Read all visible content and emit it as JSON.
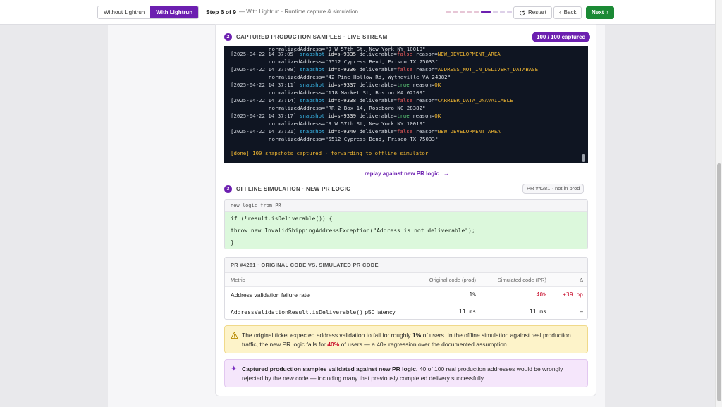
{
  "toolbar": {
    "mode_without": "Without Lightrun",
    "mode_with": "With Lightrun",
    "step": "Step 6 of 9",
    "step_sub": "— With Lightrun · Runtime capture & simulation",
    "restart": "Restart",
    "back": "Back",
    "next": "Next"
  },
  "progress": {
    "total_steps": 9,
    "current_step": 6
  },
  "colors": {
    "accent": "#6c1fb0",
    "next_green": "#1b8a35",
    "error_red": "#c8102e"
  },
  "section2": {
    "number": "2",
    "title": "CAPTURED PRODUCTION SAMPLES · LIVE STREAM",
    "badge": "100 / 100 captured"
  },
  "console": {
    "top_partial_address": "normalizedAddress=\"9 W 57th St, New York NY 10019\"",
    "entries": [
      {
        "ts": "[2025-04-22 14:37:05]",
        "kw": "snapshot",
        "id": "id=s-9335",
        "d_label": "deliverable=",
        "d_val": "false",
        "r_label": "reason=",
        "reason": "NEW_DEVELOPMENT_AREA",
        "address": "normalizedAddress=\"5512 Cypress Bend, Frisco TX 75033\""
      },
      {
        "ts": "[2025-04-22 14:37:08]",
        "kw": "snapshot",
        "id": "id=s-9336",
        "d_label": "deliverable=",
        "d_val": "false",
        "r_label": "reason=",
        "reason": "ADDRESS_NOT_IN_DELIVERY_DATABASE",
        "address": "normalizedAddress=\"42 Pine Hollow Rd, Wytheville VA 24382\""
      },
      {
        "ts": "[2025-04-22 14:37:11]",
        "kw": "snapshot",
        "id": "id=s-9337",
        "d_label": "deliverable=",
        "d_val": "true",
        "r_label": "reason=",
        "reason": "OK",
        "address": "normalizedAddress=\"118 Market St, Boston MA 02109\""
      },
      {
        "ts": "[2025-04-22 14:37:14]",
        "kw": "snapshot",
        "id": "id=s-9338",
        "d_label": "deliverable=",
        "d_val": "false",
        "r_label": "reason=",
        "reason": "CARRIER_DATA_UNAVAILABLE",
        "address": "normalizedAddress=\"RR 2 Box 14, Roseboro NC 28382\""
      },
      {
        "ts": "[2025-04-22 14:37:17]",
        "kw": "snapshot",
        "id": "id=s-9339",
        "d_label": "deliverable=",
        "d_val": "true",
        "r_label": "reason=",
        "reason": "OK",
        "address": "normalizedAddress=\"9 W 57th St, New York NY 10019\""
      },
      {
        "ts": "[2025-04-22 14:37:21]",
        "kw": "snapshot",
        "id": "id=s-9340",
        "d_label": "deliverable=",
        "d_val": "false",
        "r_label": "reason=",
        "reason": "NEW_DEVELOPMENT_AREA",
        "address": "normalizedAddress=\"5512 Cypress Bend, Frisco TX 75033\""
      }
    ],
    "done": "[done] 100 snapshots captured · forwarding to offline simulator"
  },
  "replay_link": "replay against new PR logic",
  "section3": {
    "number": "3",
    "title": "OFFLINE SIMULATION · NEW PR LOGIC",
    "badge": "PR #4281 · not in prod"
  },
  "code": {
    "label": "new logic from PR",
    "lines": [
      "if (!result.isDeliverable()) {",
      "throw new InvalidShippingAddressException(\"Address is not deliverable\");",
      "}"
    ]
  },
  "comparison": {
    "title": "PR #4281 · ORIGINAL CODE VS. SIMULATED PR CODE",
    "headers": {
      "metric": "Metric",
      "original": "Original code (prod)",
      "simulated": "Simulated code (PR)",
      "delta": "Δ"
    },
    "rows": [
      {
        "metric": "Address validation failure rate",
        "metric_code": "",
        "metric_suffix": "",
        "original": "1%",
        "simulated": "40%",
        "delta": "+39 pp"
      },
      {
        "metric": "",
        "metric_code": "AddressValidationResult.isDeliverable()",
        "metric_suffix": " p50 latency",
        "original": "11 ms",
        "simulated": "11 ms",
        "delta": "–"
      }
    ]
  },
  "warning": {
    "part1": "The original ticket expected address validation to fail for roughly ",
    "bold1": "1%",
    "part2": " of users. In the offline simulation against real production traffic, the new PR logic fails for ",
    "bold2": "40%",
    "part3": " of users — a 40× regression over the documented assumption."
  },
  "info": {
    "bold": "Captured production samples validated against new PR logic.",
    "text": " 40 of 100 real production addresses would be wrongly rejected by the new code — including many that previously completed delivery successfully."
  }
}
